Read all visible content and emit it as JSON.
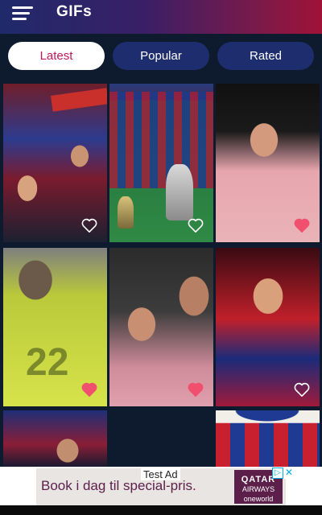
{
  "appbar": {
    "title": "GIFs",
    "menu_icon": "hamburger-icon"
  },
  "tabs": [
    {
      "label": "Latest",
      "active": true
    },
    {
      "label": "Popular",
      "active": false
    },
    {
      "label": "Rated",
      "active": false
    }
  ],
  "gifs": [
    {
      "favorited": false
    },
    {
      "favorited": false
    },
    {
      "favorited": true
    },
    {
      "favorited": true
    },
    {
      "favorited": true
    },
    {
      "favorited": false
    },
    {
      "favorited": false
    },
    {
      "favorited": false
    },
    {
      "favorited": false
    }
  ],
  "ad": {
    "label": "Test Ad",
    "headline": "Book i dag til special-pris.",
    "brand": "QATAR",
    "brand_sub": "AIRWAYS",
    "alliance": "oneworld"
  },
  "colors": {
    "accent": "#c2185b",
    "tab_inactive": "#1d2d6e",
    "background": "#0e1a2e",
    "heart_filled": "#f0506e"
  }
}
